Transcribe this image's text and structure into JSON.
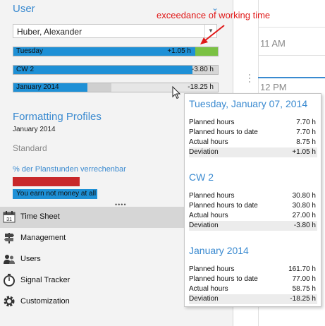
{
  "user_section": {
    "title": "User",
    "selected_user": "Huber, Alexander",
    "bars": [
      {
        "label": "Tuesday",
        "value": "+1.05 h",
        "planned_fraction": 0.89,
        "over_fraction": 0.11,
        "state": "overtime"
      },
      {
        "label": "CW 2",
        "value": "-3.80 h",
        "planned_fraction": 0.877,
        "over_fraction": 0,
        "state": "under"
      },
      {
        "label": "January 2014",
        "value": "-18.25 h",
        "planned_fraction": 0.76,
        "over_fraction": 0,
        "state": "under"
      }
    ]
  },
  "annotation": "exceedance of working time",
  "formatting_profiles": {
    "title": "Formatting Profiles",
    "date": "January 2014",
    "standard_label": "Standard",
    "rule_label": "% der Planstunden verrechenbar",
    "info_text": "You earn not money at all"
  },
  "navigation": [
    {
      "label": "Time Sheet",
      "icon": "calendar-icon",
      "selected": true
    },
    {
      "label": "Management",
      "icon": "signpost-icon",
      "selected": false
    },
    {
      "label": "Users",
      "icon": "users-icon",
      "selected": false
    },
    {
      "label": "Signal Tracker",
      "icon": "stopwatch-icon",
      "selected": false
    },
    {
      "label": "Customization",
      "icon": "gear-icon",
      "selected": false
    }
  ],
  "calendar": {
    "times": [
      "11 AM",
      "12 PM"
    ]
  },
  "tooltip": {
    "sections": [
      {
        "title": "Tuesday, January 07, 2014",
        "rows": [
          {
            "label": "Planned hours",
            "value": "7.70 h"
          },
          {
            "label": "Planned hours to date",
            "value": "7.70 h"
          },
          {
            "label": "Actual hours",
            "value": "8.75 h"
          },
          {
            "label": "Deviation",
            "value": "+1.05 h"
          }
        ]
      },
      {
        "title": "CW 2",
        "rows": [
          {
            "label": "Planned hours",
            "value": "30.80 h"
          },
          {
            "label": "Planned hours to date",
            "value": "30.80 h"
          },
          {
            "label": "Actual hours",
            "value": "27.00 h"
          },
          {
            "label": "Deviation",
            "value": "-3.80 h"
          }
        ]
      },
      {
        "title": "January 2014",
        "rows": [
          {
            "label": "Planned hours",
            "value": "161.70 h"
          },
          {
            "label": "Planned hours to date",
            "value": "77.00 h"
          },
          {
            "label": "Actual hours",
            "value": "58.75 h"
          },
          {
            "label": "Deviation",
            "value": "-18.25 h"
          }
        ]
      }
    ]
  },
  "colors": {
    "accent": "#3a8ad0",
    "planned_bar": "#1e90d6",
    "overtime_bar": "#7ac143",
    "annotation": "#e01818",
    "red_box": "#c8282a"
  }
}
